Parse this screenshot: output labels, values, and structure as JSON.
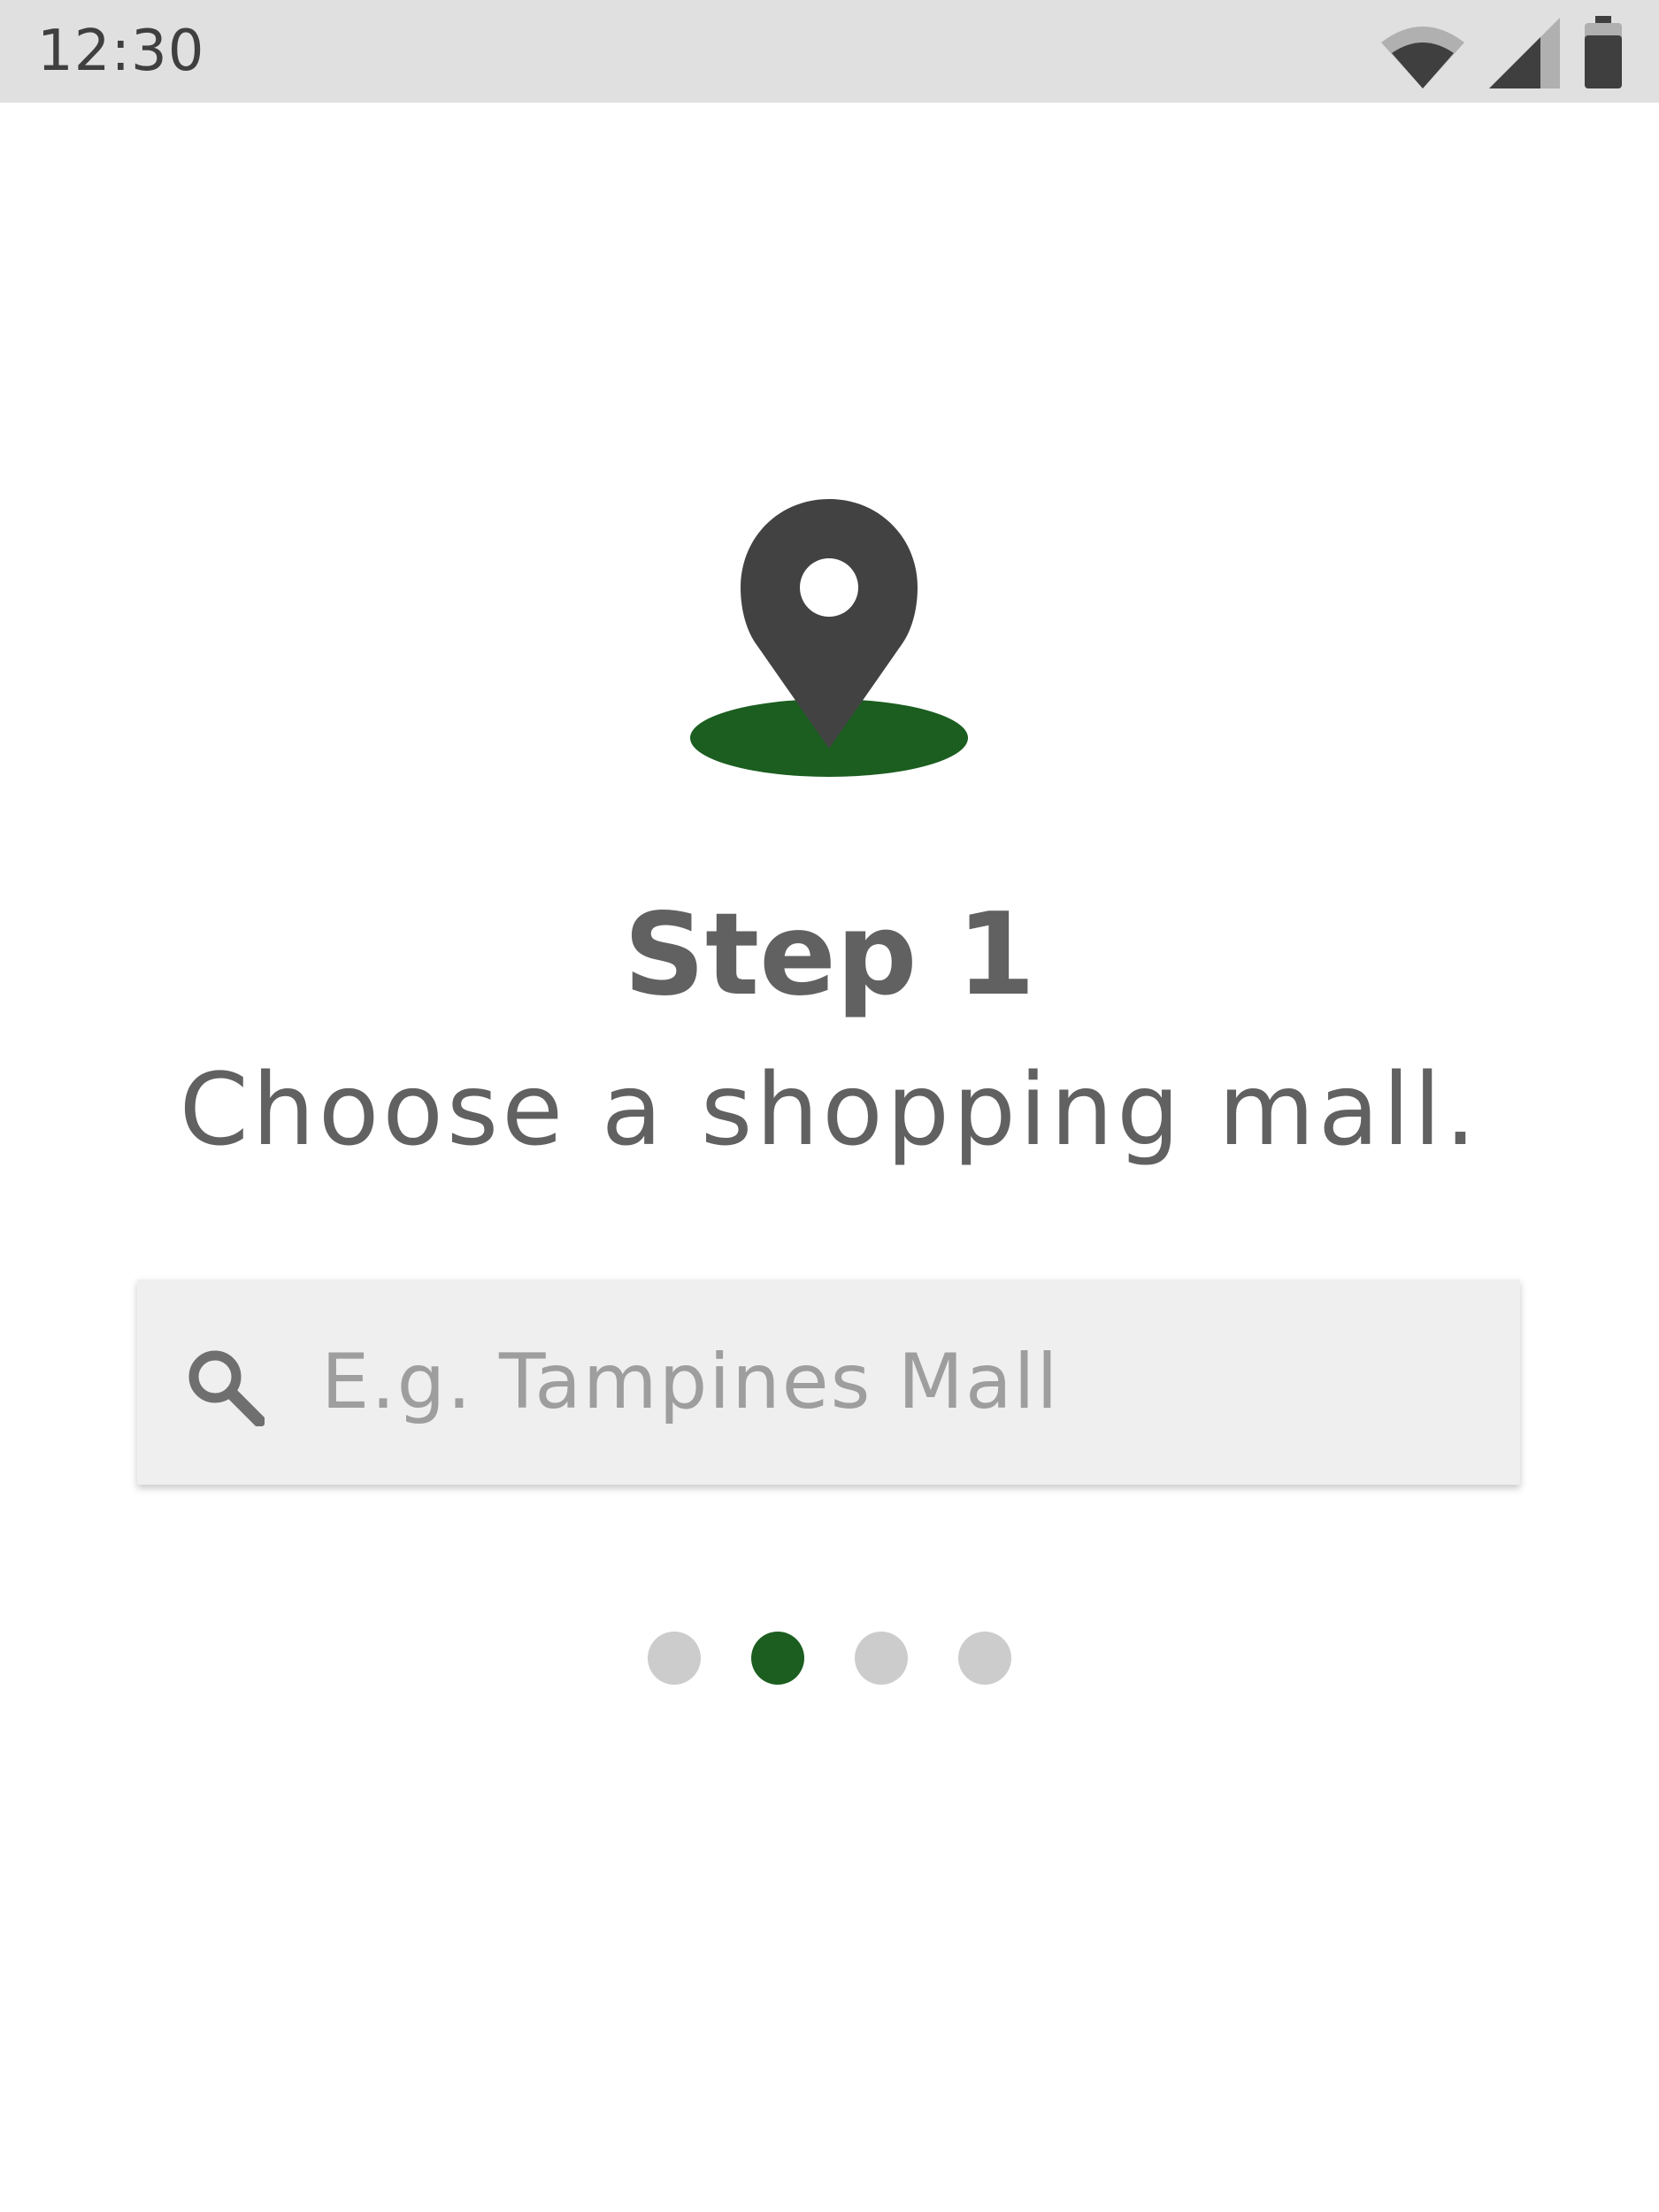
{
  "status_bar": {
    "time": "12:30",
    "icons": [
      "wifi-icon",
      "cellular-signal-icon",
      "battery-icon"
    ]
  },
  "onboarding": {
    "illustration_icon": "map-pin-icon",
    "title": "Step 1",
    "subtitle": "Choose a shopping mall."
  },
  "search": {
    "icon": "search-icon",
    "value": "",
    "placeholder": "E.g. Tampines Mall"
  },
  "pager": {
    "page_count": 4,
    "active_index": 1
  },
  "colors": {
    "accent": "#1b5e20",
    "pin": "#424242",
    "text": "#616161",
    "dot_inactive": "#cccccc",
    "status_bar_bg": "#e0e0e0"
  }
}
